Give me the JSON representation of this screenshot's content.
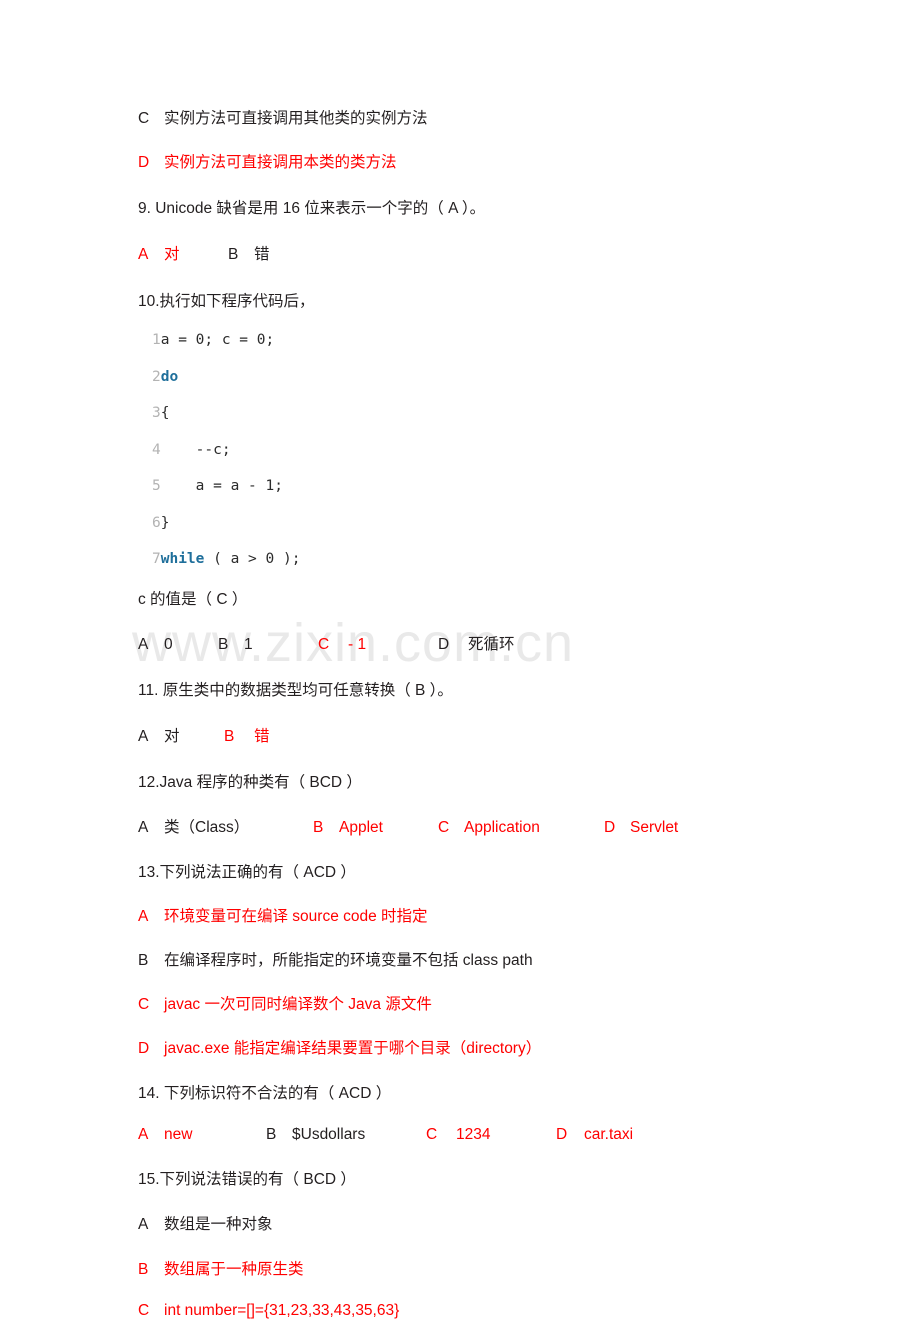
{
  "watermark": {
    "text": "www.zixin.com.cn"
  },
  "colors": {
    "answer_red": "#ff0000",
    "body_text": "#231f20",
    "line_number": "#b3b3b3",
    "keyword_blue": "#1f6f9b",
    "watermark": "#e9e9e9"
  },
  "questions": [
    {
      "id": "q8-cont",
      "options": [
        {
          "letter": "C",
          "text": "实例方法可直接调用其他类的实例方法",
          "correct": false
        },
        {
          "letter": "D",
          "text": "实例方法可直接调用本类的类方法",
          "correct": true
        }
      ]
    },
    {
      "id": "q9",
      "stem": "9. Unicode 缺省是用 16 位来表示一个字的（ A ）。",
      "options": [
        {
          "letter": "A",
          "text": "对",
          "correct": true
        },
        {
          "letter": "B",
          "text": "错",
          "correct": false
        }
      ]
    },
    {
      "id": "q10",
      "stem": "10.执行如下程序代码后，",
      "code": [
        {
          "lineno": "1",
          "text": "a = 0; c = 0;",
          "keyword": ""
        },
        {
          "lineno": "2",
          "text": "",
          "keyword": "do"
        },
        {
          "lineno": "3",
          "text": "{",
          "keyword": ""
        },
        {
          "lineno": "4",
          "text": "    --c;",
          "keyword": ""
        },
        {
          "lineno": "5",
          "text": "    a = a - 1;",
          "keyword": ""
        },
        {
          "lineno": "6",
          "text": "}",
          "keyword": ""
        },
        {
          "lineno": "7",
          "text": " ( a > 0 );",
          "keyword": "while"
        }
      ],
      "substem": "c 的值是（ C ）",
      "options": [
        {
          "letter": "A",
          "text": "0",
          "correct": false
        },
        {
          "letter": "B",
          "text": "1",
          "correct": false
        },
        {
          "letter": "C",
          "text": "- 1",
          "correct": true
        },
        {
          "letter": "D",
          "text": "死循环",
          "correct": false
        }
      ]
    },
    {
      "id": "q11",
      "stem": "11. 原生类中的数据类型均可任意转换（ B ）。",
      "options": [
        {
          "letter": "A",
          "text": "对",
          "correct": false
        },
        {
          "letter": "B",
          "text": "错",
          "correct": true
        }
      ]
    },
    {
      "id": "q12",
      "stem": "12.Java 程序的种类有（ BCD ）",
      "options": [
        {
          "letter": "A",
          "text": "类（Class）",
          "correct": false
        },
        {
          "letter": "B",
          "text": "Applet",
          "correct": true
        },
        {
          "letter": "C",
          "text": "Application",
          "correct": true
        },
        {
          "letter": "D",
          "text": "Servlet",
          "correct": true
        }
      ]
    },
    {
      "id": "q13",
      "stem": "13.下列说法正确的有（ ACD ）",
      "options": [
        {
          "letter": "A",
          "text": "环境变量可在编译 source code 时指定",
          "correct": true
        },
        {
          "letter": "B",
          "text": "在编译程序时，所能指定的环境变量不包括 class path",
          "correct": false
        },
        {
          "letter": "C",
          "text": "javac 一次可同时编译数个 Java 源文件",
          "correct": true
        },
        {
          "letter": "D",
          "text": "javac.exe 能指定编译结果要置于哪个目录（directory）",
          "correct": true
        }
      ]
    },
    {
      "id": "q14",
      "stem": "14. 下列标识符不合法的有（ ACD ）",
      "options": [
        {
          "letter": "A",
          "text": "new",
          "correct": true
        },
        {
          "letter": "B",
          "text": "$Usdollars",
          "correct": false
        },
        {
          "letter": "C",
          "text": "1234",
          "correct": true
        },
        {
          "letter": "D",
          "text": "car.taxi",
          "correct": true
        }
      ]
    },
    {
      "id": "q15",
      "stem": "15.下列说法错误的有（ BCD ）",
      "options": [
        {
          "letter": "A",
          "text": "数组是一种对象",
          "correct": false
        },
        {
          "letter": "B",
          "text": "数组属于一种原生类",
          "correct": true
        },
        {
          "letter": "C",
          "text": "int number=[]={31,23,33,43,35,63}",
          "correct": true
        }
      ]
    }
  ]
}
